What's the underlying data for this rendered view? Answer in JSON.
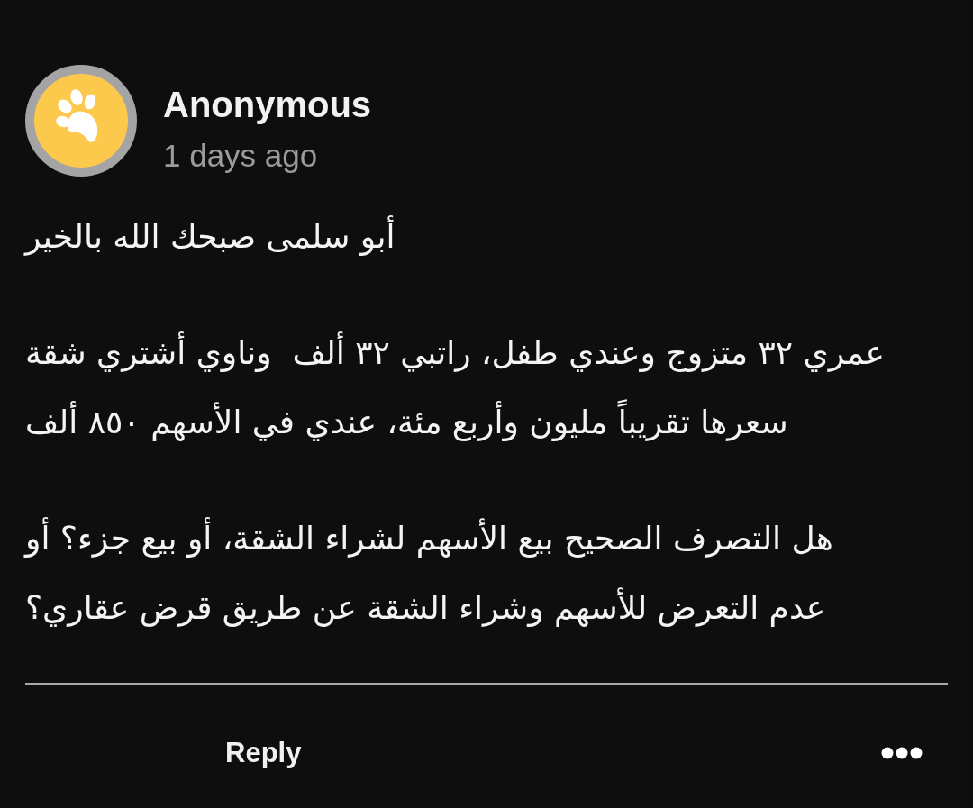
{
  "comment": {
    "author": "Anonymous",
    "time": "1 days ago",
    "paragraphs": [
      "أبو سلمى صبحك الله بالخير",
      "عمري ٣٢ متزوج وعندي طفل، راتبي ٣٢ ألف  وناوي أشتري شقة سعرها تقريباً مليون وأربع مئة، عندي في الأسهم ٨٥٠ ألف",
      "هل التصرف الصحيح بيع الأسهم لشراء الشقة، أو بيع جزء؟ أو عدم التعرض للأسهم وشراء الشقة عن طريق قرض عقاري؟"
    ]
  },
  "actions": {
    "reply": "Reply"
  }
}
